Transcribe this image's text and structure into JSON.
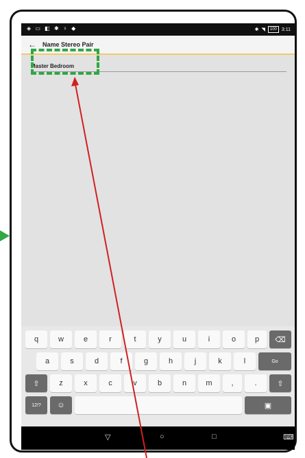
{
  "status_bar": {
    "left_icons": "◈ ▭ ◧ ✱ ♀ ◆",
    "time": "3:11",
    "battery": "100"
  },
  "app_bar": {
    "back_icon": "←",
    "title": "Name Stereo Pair"
  },
  "name_field": {
    "value": "Master Bedroom"
  },
  "keyboard": {
    "row1": [
      "q",
      "w",
      "e",
      "r",
      "t",
      "y",
      "u",
      "i",
      "o",
      "p"
    ],
    "row1_backspace_icon": "⌫",
    "row2": [
      "a",
      "s",
      "d",
      "f",
      "g",
      "h",
      "j",
      "k",
      "l"
    ],
    "go_label": "Go",
    "row3": [
      "z",
      "x",
      "c",
      "v",
      "b",
      "n",
      "m",
      ",",
      "."
    ],
    "shift_icon": "⇧",
    "symbols_label": "12!?",
    "emoji_icon": "☺",
    "hide_keyboard_icon": "▣"
  },
  "nav_bar": {
    "back_icon": "▽",
    "home_icon": "○",
    "recents_icon": "□",
    "keyboard_icon": "⌨"
  },
  "annotation": {
    "highlight_color": "#2fa845",
    "arrow_color": "#d12020",
    "side_arrow_color": "#2fa845"
  }
}
